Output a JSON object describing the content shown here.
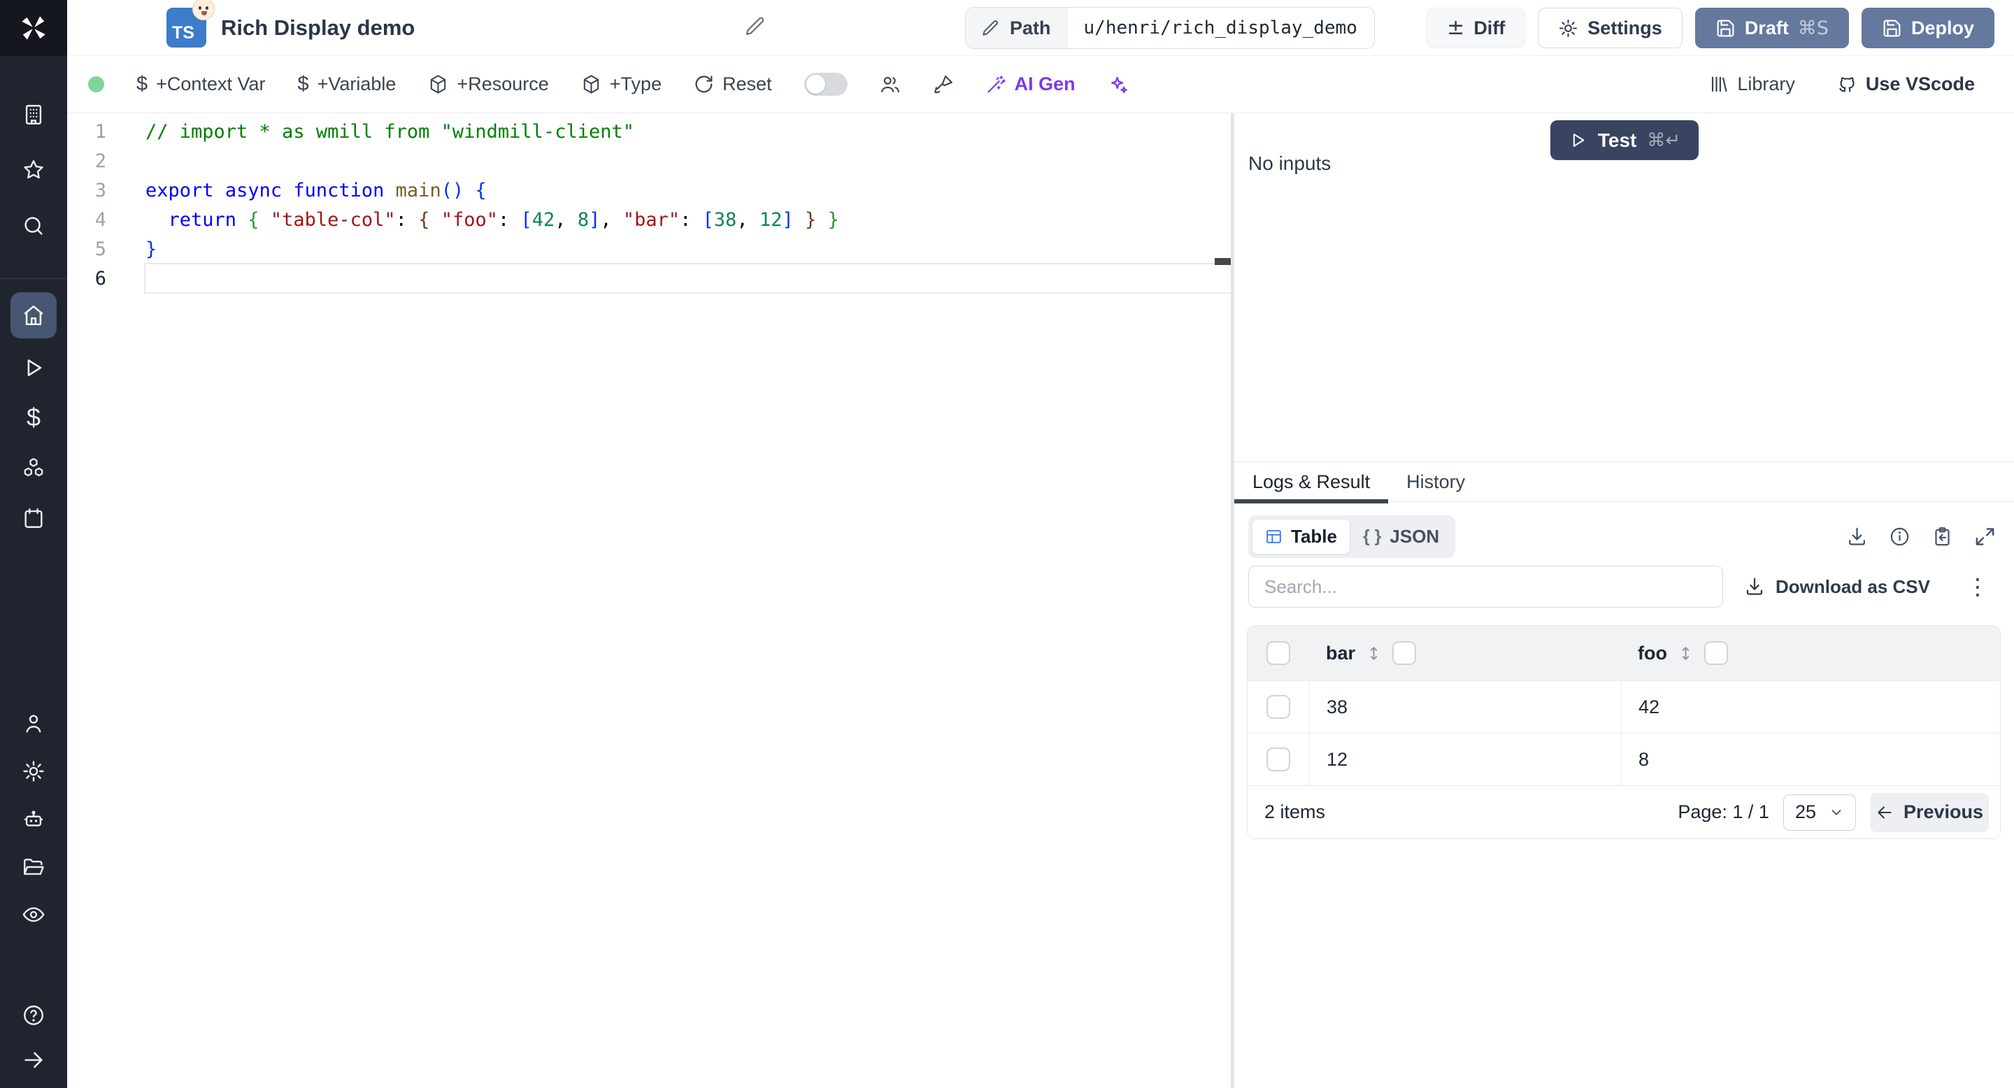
{
  "app": {
    "name": "Windmill"
  },
  "sidebar": {
    "items": [
      "workspace",
      "favorites",
      "search",
      "home",
      "runs",
      "variables",
      "resources",
      "schedules",
      "users",
      "settings",
      "workers",
      "folders",
      "audit-logs",
      "help",
      "expand"
    ]
  },
  "header": {
    "language_badge": "TS",
    "title": "Rich Display demo",
    "path_label": "Path",
    "path_value": "u/henri/rich_display_demo",
    "diff_symbol": "±",
    "diff_label": "Diff",
    "settings_label": "Settings",
    "draft_label": "Draft",
    "draft_shortcut": "⌘S",
    "deploy_label": "Deploy"
  },
  "toolbar": {
    "context_var_symbol": "$",
    "context_var_label": "+Context Var",
    "variable_symbol": "$",
    "variable_label": "+Variable",
    "resource_label": "+Resource",
    "type_label": "+Type",
    "reset_label": "Reset",
    "ai_gen_label": "AI Gen",
    "library_label": "Library",
    "vscode_label": "Use VScode",
    "status_color": "#81d49a",
    "ai_accent_color": "#7c3aed"
  },
  "editor": {
    "colors": {
      "plain": "#000000",
      "comment": "#008000",
      "keyword": "#0000ff",
      "function": "#795e26",
      "string": "#a31515",
      "number": "#098658",
      "bracket1": "#0431fa",
      "bracket2": "#319331",
      "bracket3": "#7b3814"
    },
    "active_line": 6,
    "lines": [
      {
        "number": "1",
        "tokens": [
          {
            "t": "// import * as wmill from \"windmill-client\"",
            "c": "comment"
          }
        ]
      },
      {
        "number": "2",
        "tokens": []
      },
      {
        "number": "3",
        "tokens": [
          {
            "t": "export",
            "c": "keyword"
          },
          {
            "t": " ",
            "c": "plain"
          },
          {
            "t": "async",
            "c": "keyword"
          },
          {
            "t": " ",
            "c": "plain"
          },
          {
            "t": "function",
            "c": "keyword"
          },
          {
            "t": " ",
            "c": "plain"
          },
          {
            "t": "main",
            "c": "function"
          },
          {
            "t": "(",
            "c": "bracket1"
          },
          {
            "t": ")",
            "c": "bracket1"
          },
          {
            "t": " ",
            "c": "plain"
          },
          {
            "t": "{",
            "c": "bracket1"
          }
        ]
      },
      {
        "number": "4",
        "tokens": [
          {
            "t": "  ",
            "c": "plain"
          },
          {
            "t": "return",
            "c": "keyword"
          },
          {
            "t": " ",
            "c": "plain"
          },
          {
            "t": "{",
            "c": "bracket2"
          },
          {
            "t": " ",
            "c": "plain"
          },
          {
            "t": "\"table-col\"",
            "c": "string"
          },
          {
            "t": ": ",
            "c": "plain"
          },
          {
            "t": "{",
            "c": "bracket3"
          },
          {
            "t": " ",
            "c": "plain"
          },
          {
            "t": "\"foo\"",
            "c": "string"
          },
          {
            "t": ": ",
            "c": "plain"
          },
          {
            "t": "[",
            "c": "bracket1"
          },
          {
            "t": "42",
            "c": "number"
          },
          {
            "t": ", ",
            "c": "plain"
          },
          {
            "t": "8",
            "c": "number"
          },
          {
            "t": "]",
            "c": "bracket1"
          },
          {
            "t": ", ",
            "c": "plain"
          },
          {
            "t": "\"bar\"",
            "c": "string"
          },
          {
            "t": ": ",
            "c": "plain"
          },
          {
            "t": "[",
            "c": "bracket1"
          },
          {
            "t": "38",
            "c": "number"
          },
          {
            "t": ", ",
            "c": "plain"
          },
          {
            "t": "12",
            "c": "number"
          },
          {
            "t": "]",
            "c": "bracket1"
          },
          {
            "t": " ",
            "c": "plain"
          },
          {
            "t": "}",
            "c": "bracket3"
          },
          {
            "t": " ",
            "c": "plain"
          },
          {
            "t": "}",
            "c": "bracket2"
          }
        ]
      },
      {
        "number": "5",
        "tokens": [
          {
            "t": "}",
            "c": "bracket1"
          }
        ]
      },
      {
        "number": "6",
        "tokens": []
      }
    ]
  },
  "run": {
    "test_label": "Test",
    "test_shortcut": "⌘↵",
    "no_inputs": "No inputs"
  },
  "result": {
    "tabs": [
      {
        "label": "Logs & Result"
      },
      {
        "label": "History"
      }
    ],
    "view_table_label": "Table",
    "view_json_braces": "{ }",
    "view_json_label": "JSON",
    "search_placeholder": "Search...",
    "download_csv_label": "Download as CSV",
    "kebab_glyph": "⋮",
    "table": {
      "columns": [
        "bar",
        "foo"
      ],
      "rows": [
        {
          "bar": "38",
          "foo": "42"
        },
        {
          "bar": "12",
          "foo": "8"
        }
      ]
    },
    "footer": {
      "items_text": "2 items",
      "page_text": "Page: 1 / 1",
      "page_size": "25",
      "previous_label": "Previous"
    }
  },
  "colors": {
    "primary_button": "#65789e",
    "test_button": "#384460",
    "sidebar_bg": "#20242e",
    "sidebar_active": "#475671",
    "ts_badge": "#3d7cc9"
  }
}
